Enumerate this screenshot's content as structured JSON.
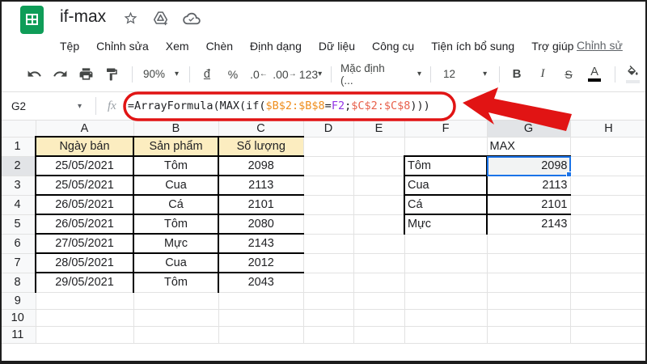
{
  "titlebar": {
    "title": "if-max"
  },
  "menus": [
    "Tệp",
    "Chỉnh sửa",
    "Xem",
    "Chèn",
    "Định dạng",
    "Dữ liệu",
    "Công cụ",
    "Tiện ích bổ sung",
    "Trợ giúp"
  ],
  "last_edit_link": "Chỉnh sử",
  "toolbar": {
    "zoom": "90%",
    "caret": "▾",
    "currency": "đ",
    "percent": "%",
    "dec_decrease": ".0",
    "dec_decrease_arrow": "←",
    "dec_increase": ".00",
    "dec_increase_arrow": "→",
    "more_formats": "123",
    "font": "Mặc định (...",
    "font_size": "12",
    "bold": "B",
    "italic": "I",
    "strikethrough": "S",
    "text_color": "A"
  },
  "formula_bar": {
    "name_box": "G2",
    "fx": "fx",
    "tokens": [
      {
        "t": "=ArrayFormula(MAX(if(",
        "c": "#202124"
      },
      {
        "t": "$B$2:$B$8",
        "c": "#ef8e1e"
      },
      {
        "t": "=",
        "c": "#202124"
      },
      {
        "t": "F2",
        "c": "#9334e6"
      },
      {
        "t": ";",
        "c": "#202124"
      },
      {
        "t": "$C$2:$C$8",
        "c": "#e8614c"
      },
      {
        "t": ")))",
        "c": "#202124"
      }
    ]
  },
  "grid": {
    "col_headers": [
      "A",
      "B",
      "C",
      "D",
      "E",
      "F",
      "G",
      "H"
    ],
    "row_headers": [
      "1",
      "2",
      "3",
      "4",
      "5",
      "6",
      "7",
      "8",
      "9",
      "10",
      "11"
    ],
    "left_table": {
      "headers": [
        "Ngày bán",
        "Sản phẩm",
        "Số lượng"
      ],
      "rows": [
        [
          "25/05/2021",
          "Tôm",
          "2098"
        ],
        [
          "25/05/2021",
          "Cua",
          "2113"
        ],
        [
          "26/05/2021",
          "Cá",
          "2101"
        ],
        [
          "26/05/2021",
          "Tôm",
          "2080"
        ],
        [
          "27/05/2021",
          "Mực",
          "2143"
        ],
        [
          "28/05/2021",
          "Cua",
          "2012"
        ],
        [
          "29/05/2021",
          "Tôm",
          "2043"
        ]
      ]
    },
    "right_table": {
      "title": "MAX",
      "rows": [
        [
          "Tôm",
          "2098"
        ],
        [
          "Cua",
          "2113"
        ],
        [
          "Cá",
          "2101"
        ],
        [
          "Mực",
          "2143"
        ]
      ]
    },
    "selected_cell": "G2"
  },
  "colors": {
    "logo_green": "#0f9d58",
    "selection_blue": "#1a73e8",
    "annotation_red": "#e11414",
    "table_header_yellow": "#fcedc0",
    "header_highlight_grey": "#e2e4e7"
  }
}
